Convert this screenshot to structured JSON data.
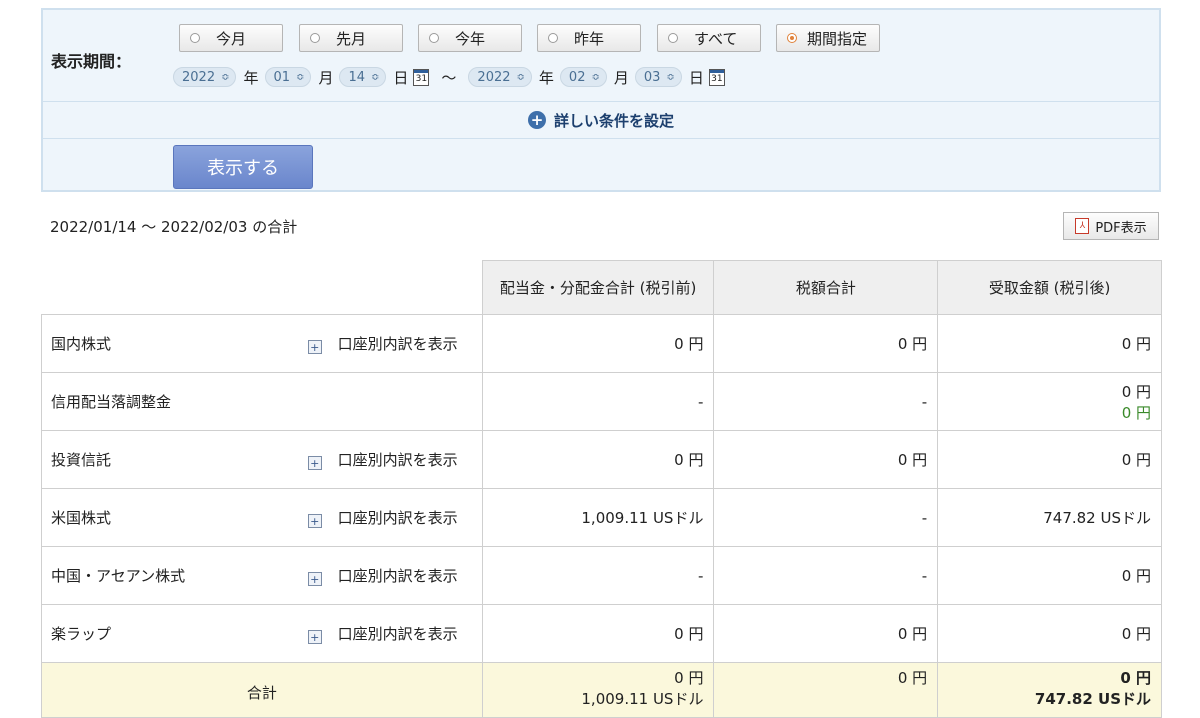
{
  "filter": {
    "label": "表示期間：",
    "buttons": [
      {
        "label": "今月",
        "selected": false
      },
      {
        "label": "先月",
        "selected": false
      },
      {
        "label": "今年",
        "selected": false
      },
      {
        "label": "昨年",
        "selected": false
      },
      {
        "label": "すべて",
        "selected": false
      },
      {
        "label": "期間指定",
        "selected": true
      }
    ],
    "from": {
      "year": "2022",
      "month": "01",
      "day": "14"
    },
    "to": {
      "year": "2022",
      "month": "02",
      "day": "03"
    },
    "unit_year": "年",
    "unit_month": "月",
    "unit_day": "日",
    "tilde": "〜",
    "calendar_day": "31",
    "detail_label": "詳しい条件を設定",
    "show_button": "表示する"
  },
  "summary": {
    "range_text": "2022/01/14 〜 2022/02/03 の合計",
    "pdf_button": "PDF表示",
    "pdf_icon_glyph": "⅄"
  },
  "table": {
    "headers": [
      "配当金・分配金合計 (税引前)",
      "税額合計",
      "受取金額 (税引後)"
    ],
    "account_link": "口座別内訳を表示",
    "plus_glyph": "+",
    "rows": [
      {
        "name": "国内株式",
        "has_link": true,
        "pretax": [
          "0 円"
        ],
        "tax": [
          "0 円"
        ],
        "net": [
          "0 円"
        ]
      },
      {
        "name": "信用配当落調整金",
        "has_link": false,
        "pretax": [
          "-"
        ],
        "tax": [
          "-"
        ],
        "net": [
          "0 円",
          "0 円"
        ]
      },
      {
        "name": "投資信託",
        "has_link": true,
        "pretax": [
          "0 円"
        ],
        "tax": [
          "0 円"
        ],
        "net": [
          "0 円"
        ]
      },
      {
        "name": "米国株式",
        "has_link": true,
        "pretax": [
          "1,009.11 USドル"
        ],
        "tax": [
          "-"
        ],
        "net": [
          "747.82 USドル"
        ]
      },
      {
        "name": "中国・アセアン株式",
        "has_link": true,
        "pretax": [
          "-"
        ],
        "tax": [
          "-"
        ],
        "net": [
          "0 円"
        ]
      },
      {
        "name": "楽ラップ",
        "has_link": true,
        "pretax": [
          "0 円"
        ],
        "tax": [
          "0 円"
        ],
        "net": [
          "0 円"
        ]
      }
    ],
    "total": {
      "label": "合計",
      "pretax": [
        "0 円",
        "1,009.11 USドル"
      ],
      "tax": [
        "0 円"
      ],
      "net": [
        "0 円",
        "747.82 USドル"
      ]
    }
  },
  "colors": {
    "accent": "#3e6faa",
    "selected_radio": "#e0823a",
    "green_value": "#3a8a2a",
    "total_bg": "#fbf8dc"
  }
}
